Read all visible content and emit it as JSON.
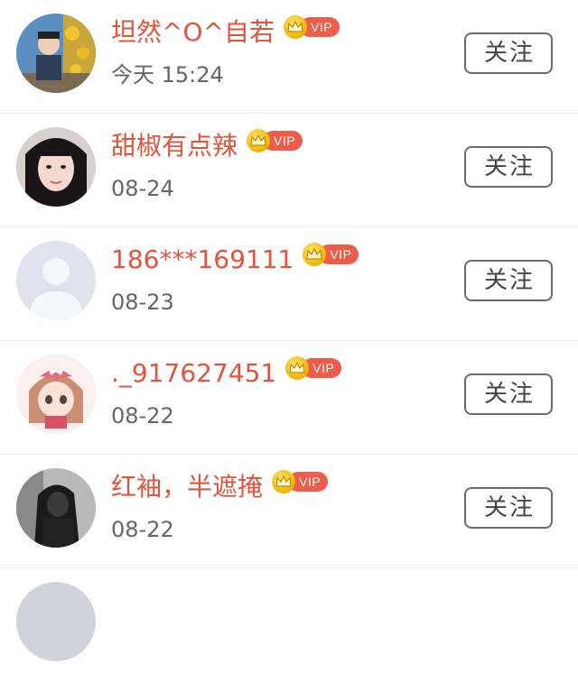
{
  "follow_list": {
    "items": [
      {
        "name": "坦然^O^自若",
        "time": "今天 15:24",
        "vip": "VIP",
        "follow_label": "关注",
        "avatar": "avatar-man-yellow-flowers"
      },
      {
        "name": "甜椒有点辣",
        "time": "08-24",
        "vip": "VIP",
        "follow_label": "关注",
        "avatar": "avatar-woman-black-hair"
      },
      {
        "name": "186***169111",
        "time": "08-23",
        "vip": "VIP",
        "follow_label": "关注",
        "avatar": "avatar-default-silhouette"
      },
      {
        "name": "._917627451",
        "time": "08-22",
        "vip": "VIP",
        "follow_label": "关注",
        "avatar": "avatar-anime-girl"
      },
      {
        "name": "红袖，半遮掩",
        "time": "08-22",
        "vip": "VIP",
        "follow_label": "关注",
        "avatar": "avatar-woman-dark"
      }
    ]
  },
  "colors": {
    "name": "#e2553b",
    "vip_badge": "#ef5d4a",
    "crown": "#f0b400",
    "time": "#666666",
    "follow_border": "#6a6a6a"
  }
}
